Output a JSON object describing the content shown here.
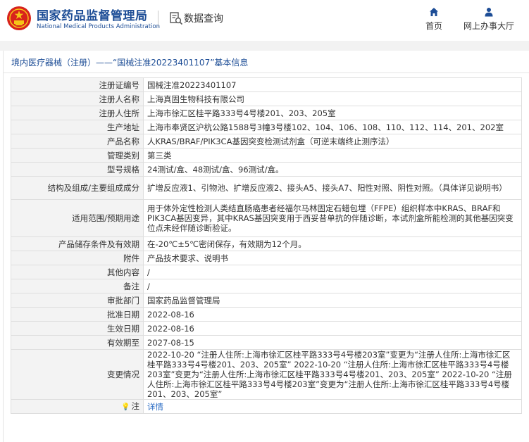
{
  "header": {
    "site_name_cn": "国家药品监督管理局",
    "site_name_en": "National Medical Products Administration",
    "data_query_label": "数据查询",
    "nav": [
      {
        "label": "首页",
        "icon": "home-icon"
      },
      {
        "label": "网上办事大厅",
        "icon": "user-icon"
      }
    ]
  },
  "breadcrumb": "境内医疗器械（注册）——“国械注准20223401107”基本信息",
  "record": {
    "rows": [
      {
        "label": "注册证编号",
        "value": "国械注准20223401107"
      },
      {
        "label": "注册人名称",
        "value": "上海真固生物科技有限公司"
      },
      {
        "label": "注册人住所",
        "value": "上海市徐汇区桂平路333号4号楼201、203、205室"
      },
      {
        "label": "生产地址",
        "value": "上海市奉贤区沪杭公路1588号3幢3号楼102、104、106、108、110、112、114、201、202室"
      },
      {
        "label": "产品名称",
        "value": "人KRAS/BRAF/PIK3CA基因突变检测试剂盒（可逆末端终止测序法）"
      },
      {
        "label": "管理类别",
        "value": "第三类"
      },
      {
        "label": "型号规格",
        "value": "24测试/盒、48测试/盒、96测试/盒。"
      },
      {
        "label": "结构及组成/主要组成成分",
        "value": "扩增反应液1、引物池、扩增反应液2、接头A5、接头A7、阳性对照、阴性对照。（具体详见说明书）"
      },
      {
        "label": "适用范围/预期用途",
        "value": "用于体外定性检测人类结直肠癌患者经福尔马林固定石蜡包埋（FFPE）组织样本中KRAS、BRAF和PIK3CA基因变异，其中KRAS基因突变用于西妥昔单抗的伴随诊断，本试剂盒所能检测的其他基因突变位点未经伴随诊断验证。"
      },
      {
        "label": "产品储存条件及有效期",
        "value": "在-20℃±5℃密闭保存，有效期为12个月。"
      },
      {
        "label": "附件",
        "value": "产品技术要求、说明书"
      },
      {
        "label": "其他内容",
        "value": "/"
      },
      {
        "label": "备注",
        "value": "/"
      },
      {
        "label": "审批部门",
        "value": "国家药品监督管理局"
      },
      {
        "label": "批准日期",
        "value": "2022-08-16"
      },
      {
        "label": "生效日期",
        "value": "2022-08-16"
      },
      {
        "label": "有效期至",
        "value": "2027-08-15"
      },
      {
        "label": "变更情况",
        "value": "2022-10-20 “注册人住所:上海市徐汇区桂平路333号4号楼203室”变更为“注册人住所:上海市徐汇区桂平路333号4号楼201、203、205室” 2022-10-20 “注册人住所:上海市徐汇区桂平路333号4号楼203室”变更为“注册人住所:上海市徐汇区桂平路333号4号楼201、203、205室” 2022-10-20 “注册人住所:上海市徐汇区桂平路333号4号楼203室”变更为“注册人住所:上海市徐汇区桂平路333号4号楼201、203、205室”"
      }
    ],
    "note": {
      "label": "注",
      "link_text": "详情",
      "icon": "lightbulb-icon"
    }
  },
  "colors": {
    "brand_blue": "#1d4d96",
    "link_blue": "#2b6cc4",
    "label_bg": "#f3f3f3",
    "border": "#dedede",
    "emblem_red": "#d8231c",
    "emblem_gold": "#f5c518"
  }
}
